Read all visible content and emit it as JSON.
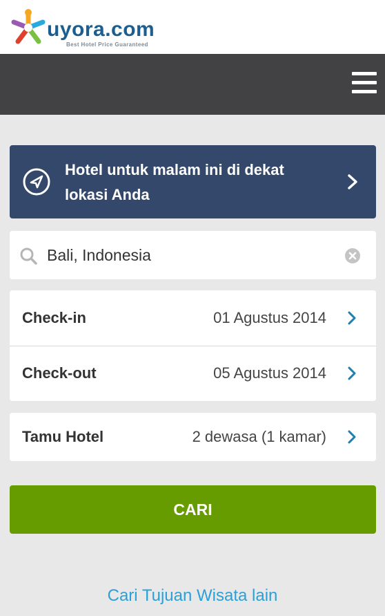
{
  "header": {
    "brand_name": "uyora.com",
    "brand_tagline": "Best Hotel Price Guaranteed",
    "menu_icon": "hamburger-menu-icon"
  },
  "promo": {
    "text": "Hotel untuk malam ini di dekat lokasi Anda",
    "icon": "location-arrow-icon"
  },
  "search": {
    "value": "Bali, Indonesia",
    "icon": "search-icon",
    "clear_icon": "clear-icon"
  },
  "dates": {
    "checkin_label": "Check-in",
    "checkin_value": "01 Agustus 2014",
    "checkout_label": "Check-out",
    "checkout_value": "05 Agustus 2014"
  },
  "guests": {
    "label": "Tamu Hotel",
    "value": "2 dewasa (1 kamar)"
  },
  "search_button": {
    "label": "CARI"
  },
  "other_destinations_link": "Cari Tujuan Wisata lain",
  "colors": {
    "navbar": "#424144",
    "promo_bg": "#34486b",
    "button_green": "#679c00",
    "link_blue": "#2ba0d8",
    "chevron_blue": "#1f7fb0",
    "brand_blue": "#1b5e8f"
  }
}
